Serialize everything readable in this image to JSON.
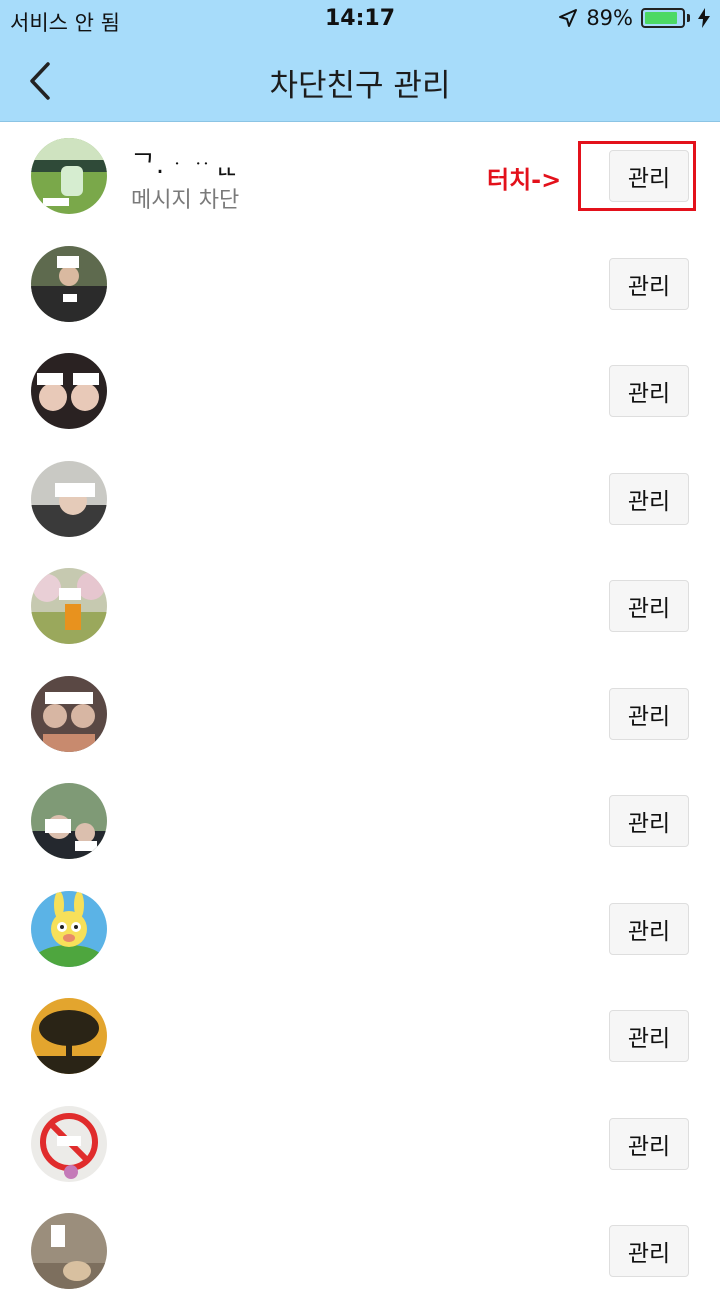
{
  "status_bar": {
    "carrier": "서비스 안 됨",
    "time": "14:17",
    "battery_percent": "89%",
    "battery_level": 0.89,
    "location_icon": "location-arrow-icon",
    "charging_icon": "lightning-icon"
  },
  "nav": {
    "title": "차단친구 관리",
    "back_icon": "chevron-left-icon"
  },
  "annotation": {
    "text": "터치->",
    "color": "#e3111b"
  },
  "colors": {
    "header_bg": "#a7dcfa",
    "battery_fill": "#4cd964"
  },
  "friends": [
    {
      "name": "ᄀ.ᆞᆢᆫᆫ",
      "subtitle": "메시지 차단",
      "button": "관리",
      "avatar": "avatar-photo-field"
    },
    {
      "name": "",
      "subtitle": "",
      "button": "관리",
      "avatar": "avatar-photo-motorbike"
    },
    {
      "name": "",
      "subtitle": "",
      "button": "관리",
      "avatar": "avatar-photo-two-people"
    },
    {
      "name": "",
      "subtitle": "",
      "button": "관리",
      "avatar": "avatar-photo-person"
    },
    {
      "name": "",
      "subtitle": "",
      "button": "관리",
      "avatar": "avatar-photo-blossom"
    },
    {
      "name": "",
      "subtitle": "",
      "button": "관리",
      "avatar": "avatar-photo-group"
    },
    {
      "name": "",
      "subtitle": "",
      "button": "관리",
      "avatar": "avatar-photo-couple"
    },
    {
      "name": "",
      "subtitle": "",
      "button": "관리",
      "avatar": "avatar-character-muzi"
    },
    {
      "name": "",
      "subtitle": "",
      "button": "관리",
      "avatar": "avatar-tree-silhouette"
    },
    {
      "name": "",
      "subtitle": "",
      "button": "관리",
      "avatar": "avatar-no-sign"
    },
    {
      "name": "",
      "subtitle": "",
      "button": "관리",
      "avatar": "avatar-photo-dog"
    }
  ]
}
